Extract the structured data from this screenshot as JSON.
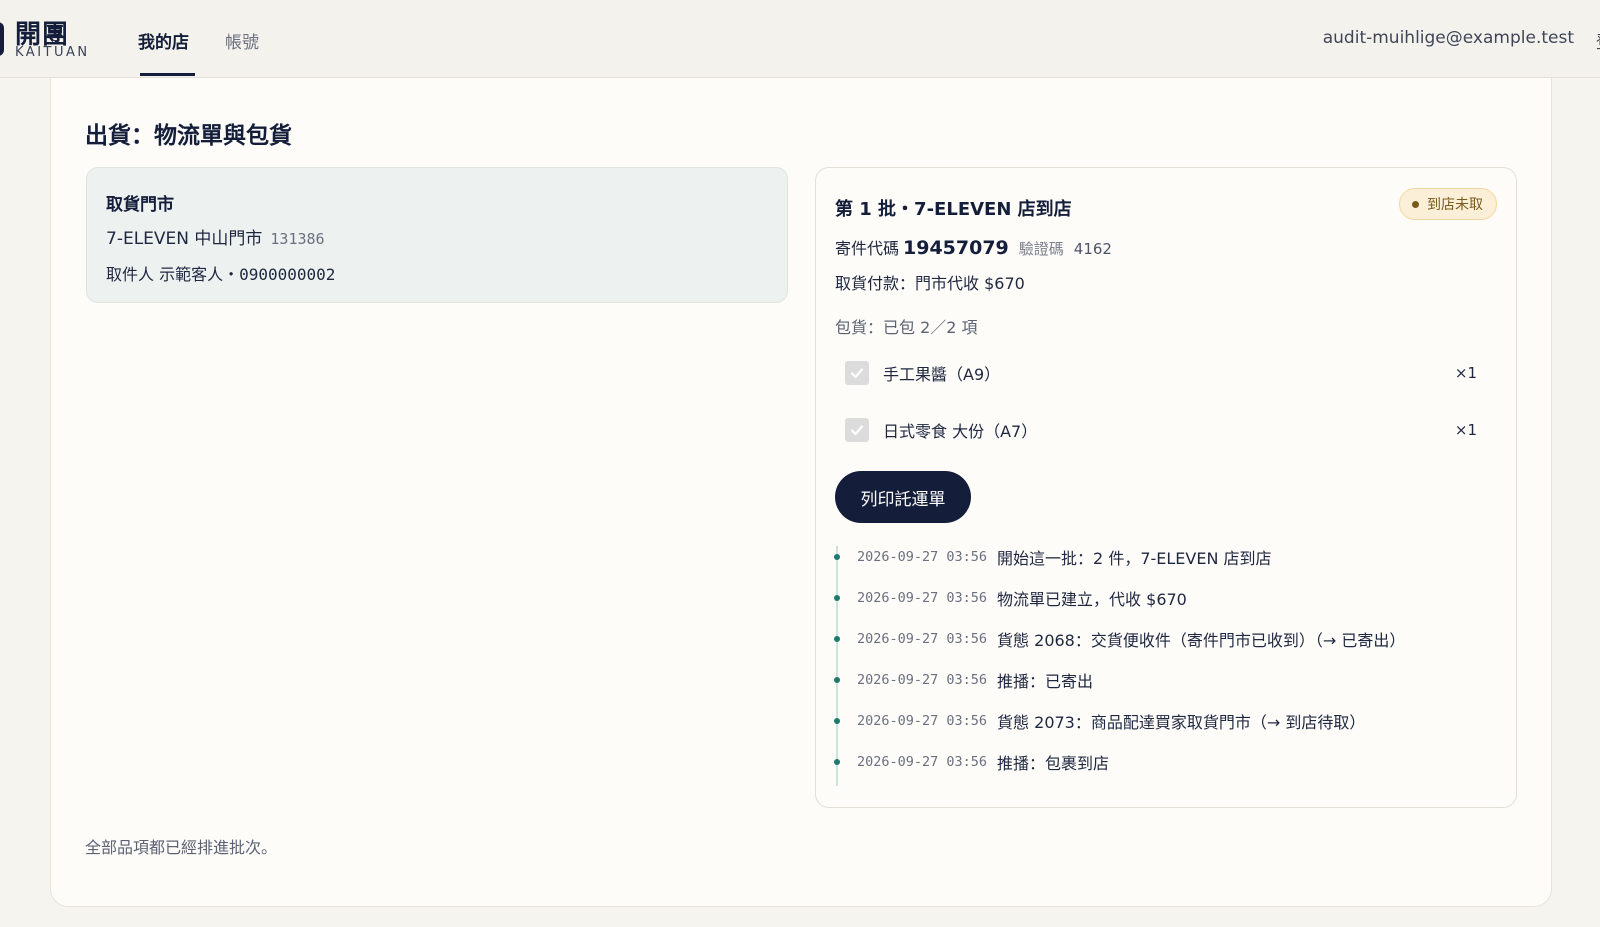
{
  "header": {
    "brand_title": "開團",
    "brand_subtitle": "KAITUAN",
    "tabs": [
      {
        "label": "我的店",
        "active": true
      },
      {
        "label": "帳號",
        "active": false
      }
    ],
    "account_email": "audit-muihlige@example.test"
  },
  "page": {
    "title": "出貨：物流單與包貨"
  },
  "pickup": {
    "heading": "取貨門市",
    "store_name": "7-ELEVEN 中山門市",
    "store_code": "131386",
    "recipient_label": "取件人 示範客人・",
    "recipient_phone": "0900000002"
  },
  "batch": {
    "title": "第 1 批・7-ELEVEN 店到店",
    "status": "到店未取",
    "tracking_label": "寄件代碼",
    "tracking_number": "19457079",
    "verify_label": "驗證碼",
    "verify_code": "4162",
    "payment": "取貨付款：門市代收 $670",
    "packing_summary": "包貨：已包 2／2 項",
    "items": [
      {
        "name": "手工果醬（A9）",
        "qty": "×1",
        "checked": true
      },
      {
        "name": "日式零食 大份（A7）",
        "qty": "×1",
        "checked": true
      }
    ],
    "print_button": "列印託運單",
    "timeline": [
      {
        "time": "2026-09-27 03:56",
        "text": "開始這一批：2 件，7-ELEVEN 店到店"
      },
      {
        "time": "2026-09-27 03:56",
        "text": "物流單已建立，代收 $670"
      },
      {
        "time": "2026-09-27 03:56",
        "text": "貨態 2068：交貨便收件（寄件門市已收到）（→ 已寄出）"
      },
      {
        "time": "2026-09-27 03:56",
        "text": "推播：已寄出"
      },
      {
        "time": "2026-09-27 03:56",
        "text": "貨態 2073：商品配達買家取貨門市（→ 到店待取）"
      },
      {
        "time": "2026-09-27 03:56",
        "text": "推播：包裹到店"
      }
    ]
  },
  "footer_note": "全部品項都已經排進批次。",
  "colors": {
    "navy": "#141e3a",
    "timeline_teal": "#1d7a6e",
    "badge_bg": "#fbf0d7",
    "badge_text": "#7a5a1c",
    "pickup_bg": "#edf1ef"
  }
}
